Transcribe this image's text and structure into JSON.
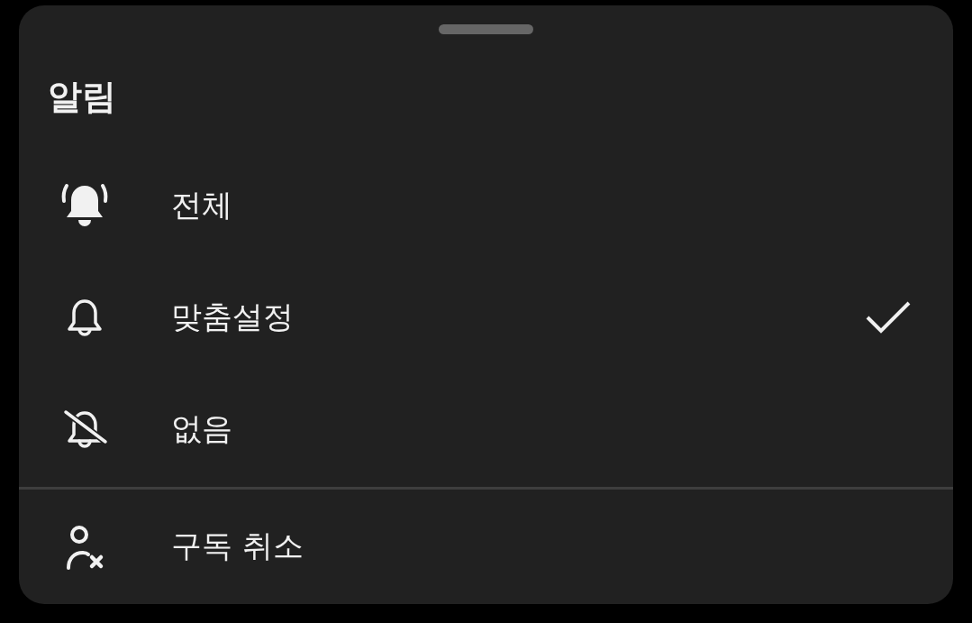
{
  "sheet": {
    "title": "알림",
    "options": [
      {
        "kind": "all",
        "label": "전체",
        "selected": false
      },
      {
        "kind": "custom",
        "label": "맞춤설정",
        "selected": true
      },
      {
        "kind": "none",
        "label": "없음",
        "selected": false
      }
    ],
    "action": {
      "label": "구독 취소"
    }
  }
}
